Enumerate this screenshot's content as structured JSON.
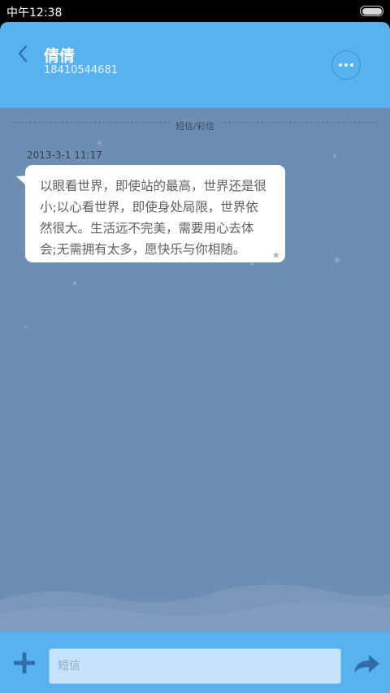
{
  "status_bar": {
    "time": "中午12:38"
  },
  "header": {
    "contact_name": "倩倩",
    "contact_phone": "18410544681",
    "icons": {
      "back": "chevron-left-icon",
      "more": "more-dots-icon"
    }
  },
  "conversation": {
    "type_label": "短信/彩信",
    "messages": [
      {
        "timestamp": "2013-3-1 11:17",
        "text": "以眼看世界，即使站的最高，世界还是很小;以心看世界，即使身处局限，世界依然很大。生活远不完美，需要用心去体会;无需拥有太多，愿快乐与你相随。",
        "starred": true
      }
    ]
  },
  "composer": {
    "placeholder": "短信",
    "value": "",
    "icons": {
      "add": "plus-icon",
      "send": "send-arrow-icon"
    }
  },
  "colors": {
    "header_bg": "#58b2f0",
    "chat_bg": "#6d8eb2",
    "bubble_bg": "#ffffff",
    "input_bg": "#c5e3fa",
    "accent_dark": "#2f6ea8"
  }
}
